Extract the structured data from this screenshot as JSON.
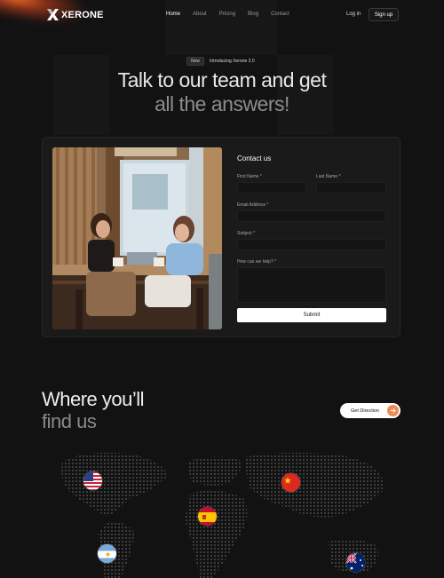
{
  "nav": {
    "brand": "XERONE",
    "links": [
      "Home",
      "About",
      "Pricing",
      "Blog",
      "Contact"
    ],
    "active": "Home",
    "login_label": "Log in",
    "signup_label": "Sign up"
  },
  "hero": {
    "pill_tag": "New",
    "pill_text": "Introducing Xerone 2.0",
    "title_line1": "Talk to our team and get",
    "title_line2": "all the answers!"
  },
  "contact": {
    "title": "Contact us",
    "first_name_label": "First Name *",
    "last_name_label": "Last Name *",
    "email_label": "Email Address *",
    "subject_label": "Subject *",
    "message_label": "How can we help? *",
    "submit_label": "Submit"
  },
  "location": {
    "title_line1": "Where you’ll",
    "title_line2": "find us",
    "direction_label": "Get Direction",
    "flags": [
      "us-flag",
      "china-flag",
      "spain-flag",
      "argentina-flag",
      "australia-flag"
    ]
  },
  "colors": {
    "background": "#121212",
    "accent": "#ef8a52",
    "card": "#1a1a1a"
  }
}
